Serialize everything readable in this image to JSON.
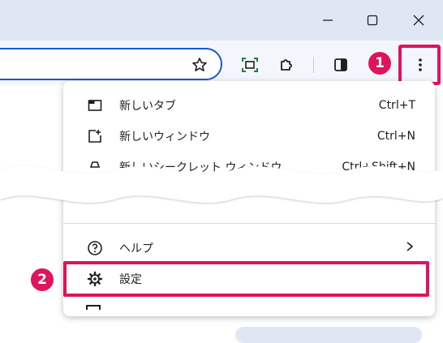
{
  "window_controls": {
    "minimize_icon": "minimize-icon",
    "maximize_icon": "maximize-icon",
    "close_icon": "close-icon"
  },
  "toolbar": {
    "bookmark_icon": "star-icon",
    "screenshot_icon": "screen-capture-icon",
    "extensions_icon": "puzzle-icon",
    "side_panel_icon": "side-panel-icon",
    "menu_icon": "three-dots-vertical-icon"
  },
  "steps": {
    "step1": "1",
    "step2": "2"
  },
  "menu": {
    "items": [
      {
        "label": "新しいタブ",
        "shortcut": "Ctrl+T",
        "icon": "new-tab-icon"
      },
      {
        "label": "新しいウィンドウ",
        "shortcut": "Ctrl+N",
        "icon": "new-window-icon"
      },
      {
        "label": "新しいシークレット ウィンドウ",
        "shortcut": "Ctrl+Shift+N",
        "icon": "incognito-icon"
      },
      {
        "label": "ヘルプ",
        "shortcut": "",
        "icon": "help-icon"
      },
      {
        "label": "設定",
        "shortcut": "",
        "icon": "settings-gear-icon"
      }
    ]
  },
  "colors": {
    "highlight": "#e0135b",
    "omnibox_border": "#1a58d0",
    "titlebar_bg": "#dfe7f4"
  }
}
